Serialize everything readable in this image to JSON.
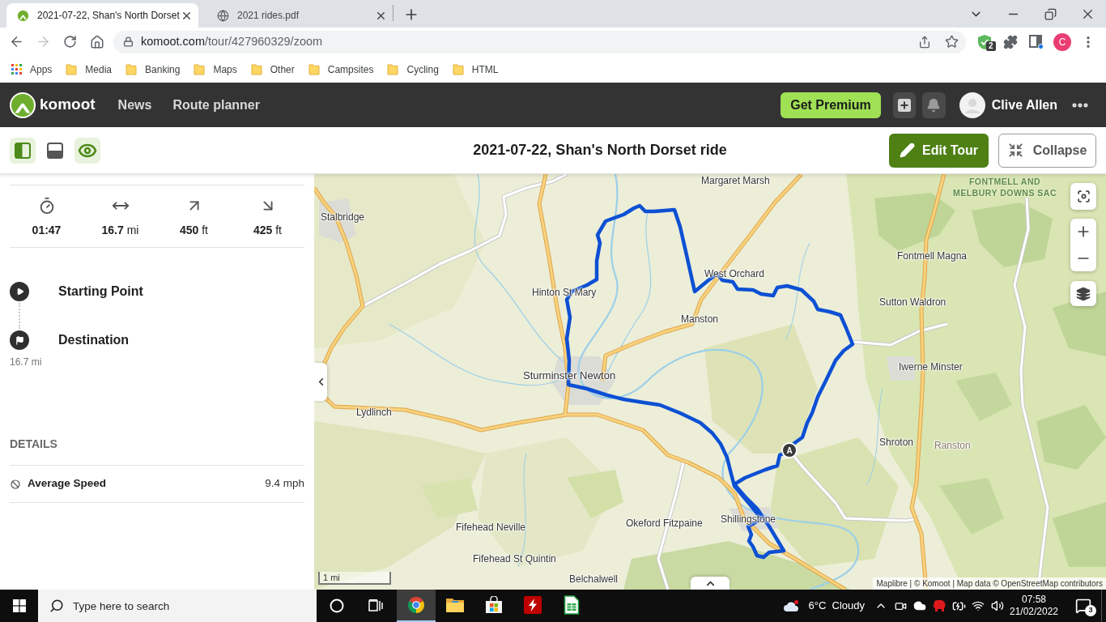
{
  "browser": {
    "tabs": [
      {
        "title": "2021-07-22, Shan's North Dorset",
        "selected": true
      },
      {
        "title": "2021 rides.pdf",
        "selected": false
      }
    ],
    "nav": {
      "back_disabled": false,
      "forward_disabled": true
    },
    "address": {
      "host": "komoot.com",
      "path": "/tour/427960329/zoom"
    },
    "extension_badge": "2",
    "profile_initial": "C",
    "bookmarks": [
      {
        "label": "Apps",
        "kind": "apps"
      },
      {
        "label": "Media",
        "kind": "folder"
      },
      {
        "label": "Banking",
        "kind": "folder"
      },
      {
        "label": "Maps",
        "kind": "folder"
      },
      {
        "label": "Other",
        "kind": "folder"
      },
      {
        "label": "Campsites",
        "kind": "folder"
      },
      {
        "label": "Cycling",
        "kind": "folder"
      },
      {
        "label": "HTML",
        "kind": "folder"
      }
    ]
  },
  "app_header": {
    "brand": "komoot",
    "nav": [
      "News",
      "Route planner"
    ],
    "premium_button": "Get Premium",
    "user_name": "Clive Allen"
  },
  "tour_bar": {
    "view_toggles": [
      {
        "selected": true
      },
      {
        "selected": false
      },
      {
        "selected": true
      }
    ],
    "title": "2021-07-22, Shan's North Dorset ride",
    "edit_button": "Edit Tour",
    "collapse_button": "Collapse"
  },
  "stats": [
    {
      "value": "01:47"
    },
    {
      "value": "16.7",
      "unit": "mi"
    },
    {
      "value": "450",
      "unit": "ft"
    },
    {
      "value": "425",
      "unit": "ft"
    }
  ],
  "waypoints": [
    {
      "kind": "start",
      "label": "Starting Point"
    },
    {
      "kind": "end",
      "label": "Destination",
      "distance": "16.7 mi"
    }
  ],
  "details": {
    "heading": "DETAILS",
    "rows": [
      {
        "label": "Average Speed",
        "value": "9.4 mph"
      }
    ]
  },
  "map": {
    "places": [
      {
        "name": "Margaret Marsh",
        "kind": "village"
      },
      {
        "name": "Stalbridge",
        "kind": "village"
      },
      {
        "name": "Fontmell Magna",
        "kind": "village"
      },
      {
        "name": "West Orchard",
        "kind": "village"
      },
      {
        "name": "Hinton St Mary",
        "kind": "village"
      },
      {
        "name": "Sutton Waldron",
        "kind": "village"
      },
      {
        "name": "Manston",
        "kind": "village"
      },
      {
        "name": "Iwerne Minster",
        "kind": "village"
      },
      {
        "name": "Sturminster Newton",
        "kind": "town"
      },
      {
        "name": "Lydlinch",
        "kind": "village"
      },
      {
        "name": "Shroton",
        "kind": "village"
      },
      {
        "name": "Ranston",
        "kind": "locality"
      },
      {
        "name": "Fifehead Neville",
        "kind": "village"
      },
      {
        "name": "Okeford Fitzpaine",
        "kind": "village"
      },
      {
        "name": "Shillingstone",
        "kind": "village"
      },
      {
        "name": "Fifehead St Quintin",
        "kind": "village"
      },
      {
        "name": "Belchalwell",
        "kind": "village"
      }
    ],
    "area_label": [
      "FONTMELL AND",
      "MELBURY DOWNS SAC"
    ],
    "marker": "A",
    "scale": "1 mi",
    "attribution": "Maplibre | © Komoot | Map data © OpenStreetMap contributors"
  },
  "taskbar": {
    "search_placeholder": "Type here to search",
    "apps": [
      {
        "selected": true
      },
      {
        "selected": false
      },
      {
        "selected": false
      },
      {
        "selected": false
      },
      {
        "selected": false
      }
    ],
    "weather": {
      "temperature": "6°C",
      "condition": "Cloudy"
    },
    "time": "07:58",
    "date": "21/02/2022",
    "notification_count": "3"
  }
}
